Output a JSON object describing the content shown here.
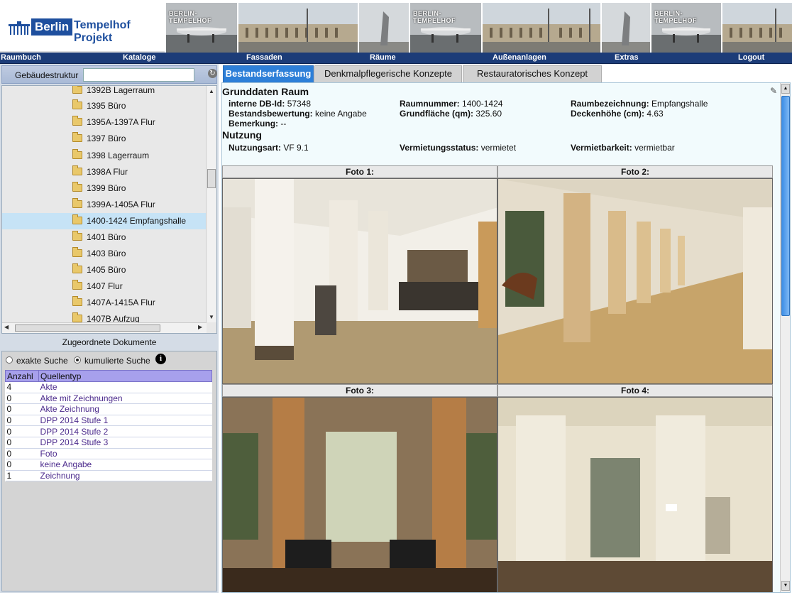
{
  "header": {
    "logo_berlin": "Berlin",
    "logo_title": "Tempelhof Projekt",
    "banner_label": "BERLIN-TEMPELHOF"
  },
  "menu": [
    {
      "label": "Raumbuch"
    },
    {
      "label": "Kataloge"
    },
    {
      "label": "Fassaden"
    },
    {
      "label": "Räume"
    },
    {
      "label": "Außenanlagen"
    },
    {
      "label": "Extras"
    },
    {
      "label": "Logout"
    }
  ],
  "tree_panel": {
    "title": "Gebäudestruktur",
    "search_value": "",
    "items": [
      {
        "label": "1392B Lagerraum"
      },
      {
        "label": "1395 Büro"
      },
      {
        "label": "1395A-1397A Flur"
      },
      {
        "label": "1397 Büro"
      },
      {
        "label": "1398 Lagerraum"
      },
      {
        "label": "1398A Flur"
      },
      {
        "label": "1399 Büro"
      },
      {
        "label": "1399A-1405A Flur"
      },
      {
        "label": "1400-1424 Empfangshalle",
        "selected": true
      },
      {
        "label": "1401 Büro"
      },
      {
        "label": "1403 Büro"
      },
      {
        "label": "1405 Büro"
      },
      {
        "label": "1407 Flur"
      },
      {
        "label": "1407A-1415A Flur"
      },
      {
        "label": "1407B Aufzug"
      }
    ]
  },
  "documents": {
    "title": "Zugeordnete Dokumente",
    "radio_exact": "exakte Suche",
    "radio_cumulative": "kumulierte Suche",
    "selected_mode": "kumulierte Suche",
    "columns": [
      "Anzahl",
      "Quellentyp"
    ],
    "rows": [
      {
        "count": "4",
        "type": "Akte"
      },
      {
        "count": "0",
        "type": "Akte mit Zeichnungen"
      },
      {
        "count": "0",
        "type": "Akte Zeichnung"
      },
      {
        "count": "0",
        "type": "DPP 2014 Stufe 1"
      },
      {
        "count": "0",
        "type": "DPP 2014 Stufe 2"
      },
      {
        "count": "0",
        "type": "DPP 2014 Stufe 3"
      },
      {
        "count": "0",
        "type": "Foto"
      },
      {
        "count": "0",
        "type": "keine Angabe"
      },
      {
        "count": "1",
        "type": "Zeichnung"
      }
    ]
  },
  "tabs": [
    {
      "label": "Bestandserfassung",
      "active": true
    },
    {
      "label": "Denkmalpflegerische Konzepte",
      "active": false
    },
    {
      "label": "Restauratorisches Konzept",
      "active": false
    }
  ],
  "grunddaten": {
    "heading": "Grunddaten Raum",
    "db_id_label": "interne DB-Id:",
    "db_id": "57348",
    "raumnummer_label": "Raumnummer:",
    "raumnummer": "1400-1424",
    "raumbezeichnung_label": "Raumbezeichnung:",
    "raumbezeichnung": "Empfangshalle",
    "bestandsbewertung_label": "Bestandsbewertung:",
    "bestandsbewertung": "keine Angabe",
    "grundflaeche_label": "Grundfläche (qm):",
    "grundflaeche": "325.60",
    "deckenhoehe_label": "Deckenhöhe (cm):",
    "deckenhoehe": "4.63",
    "bemerkung_label": "Bemerkung:",
    "bemerkung": "--"
  },
  "nutzung": {
    "heading": "Nutzung",
    "nutzungsart_label": "Nutzungsart:",
    "nutzungsart": "VF 9.1",
    "vermietungsstatus_label": "Vermietungsstatus:",
    "vermietungsstatus": "vermietet",
    "vermietbarkeit_label": "Vermietbarkeit:",
    "vermietbarkeit": "vermietbar"
  },
  "photos": [
    {
      "label": "Foto 1:"
    },
    {
      "label": "Foto 2:"
    },
    {
      "label": "Foto 3:"
    },
    {
      "label": "Foto 4:"
    }
  ],
  "colors": {
    "menubar": "#1c3c78",
    "tab_active": "#2d7fd8",
    "table_header": "#a7a0ec",
    "selected_row": "#c6e3f6"
  }
}
